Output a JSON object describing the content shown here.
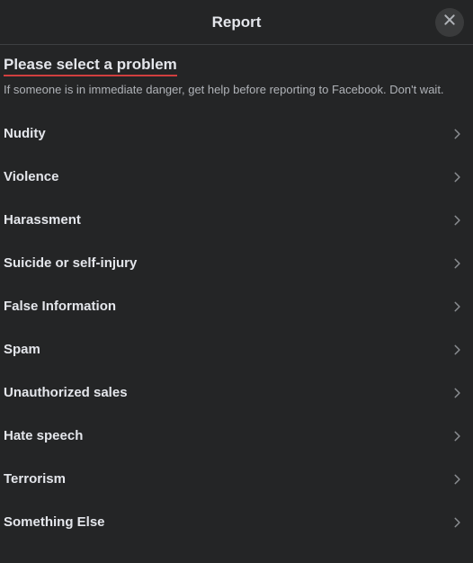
{
  "header": {
    "title": "Report"
  },
  "subtitle": "Please select a problem",
  "description": "If someone is in immediate danger, get help before reporting to Facebook. Don't wait.",
  "options": [
    {
      "label": "Nudity"
    },
    {
      "label": "Violence"
    },
    {
      "label": "Harassment"
    },
    {
      "label": "Suicide or self-injury"
    },
    {
      "label": "False Information"
    },
    {
      "label": "Spam"
    },
    {
      "label": "Unauthorized sales"
    },
    {
      "label": "Hate speech"
    },
    {
      "label": "Terrorism"
    },
    {
      "label": "Something Else"
    }
  ]
}
